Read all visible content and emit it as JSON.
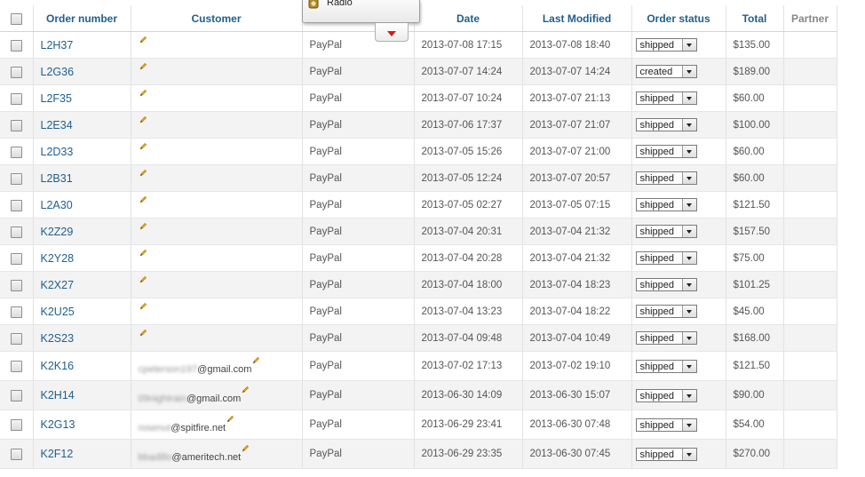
{
  "columns": {
    "order_number": "Order number",
    "customer": "Customer",
    "date": "Date",
    "last_modified": "Last Modified",
    "order_status": "Order status",
    "total": "Total",
    "partner": "Partner"
  },
  "popup": {
    "label": "Radio"
  },
  "colors": {
    "link": "#1f5f8f",
    "row_alt": "#f3f3f3",
    "toggle_arrow": "#d11a1a"
  },
  "orders": [
    {
      "number": "L2H37",
      "email_user": "",
      "email_domain": "",
      "payment": "PayPal",
      "date": "2013-07-08 17:15",
      "modified": "2013-07-08 18:40",
      "status": "shipped",
      "total": "$135.00"
    },
    {
      "number": "L2G36",
      "email_user": "",
      "email_domain": "",
      "payment": "PayPal",
      "date": "2013-07-07 14:24",
      "modified": "2013-07-07 14:24",
      "status": "created",
      "total": "$189.00"
    },
    {
      "number": "L2F35",
      "email_user": "",
      "email_domain": "",
      "payment": "PayPal",
      "date": "2013-07-07 10:24",
      "modified": "2013-07-07 21:13",
      "status": "shipped",
      "total": "$60.00"
    },
    {
      "number": "L2E34",
      "email_user": "",
      "email_domain": "",
      "payment": "PayPal",
      "date": "2013-07-06 17:37",
      "modified": "2013-07-07 21:07",
      "status": "shipped",
      "total": "$100.00"
    },
    {
      "number": "L2D33",
      "email_user": "",
      "email_domain": "",
      "payment": "PayPal",
      "date": "2013-07-05 15:26",
      "modified": "2013-07-07 21:00",
      "status": "shipped",
      "total": "$60.00"
    },
    {
      "number": "L2B31",
      "email_user": "",
      "email_domain": "",
      "payment": "PayPal",
      "date": "2013-07-05 12:24",
      "modified": "2013-07-07 20:57",
      "status": "shipped",
      "total": "$60.00"
    },
    {
      "number": "L2A30",
      "email_user": "",
      "email_domain": "",
      "payment": "PayPal",
      "date": "2013-07-05 02:27",
      "modified": "2013-07-05 07:15",
      "status": "shipped",
      "total": "$121.50"
    },
    {
      "number": "K2Z29",
      "email_user": "",
      "email_domain": "",
      "payment": "PayPal",
      "date": "2013-07-04 20:31",
      "modified": "2013-07-04 21:32",
      "status": "shipped",
      "total": "$157.50"
    },
    {
      "number": "K2Y28",
      "email_user": "",
      "email_domain": "",
      "payment": "PayPal",
      "date": "2013-07-04 20:28",
      "modified": "2013-07-04 21:32",
      "status": "shipped",
      "total": "$75.00"
    },
    {
      "number": "K2X27",
      "email_user": "",
      "email_domain": "",
      "payment": "PayPal",
      "date": "2013-07-04 18:00",
      "modified": "2013-07-04 18:23",
      "status": "shipped",
      "total": "$101.25"
    },
    {
      "number": "K2U25",
      "email_user": "",
      "email_domain": "",
      "payment": "PayPal",
      "date": "2013-07-04 13:23",
      "modified": "2013-07-04 18:22",
      "status": "shipped",
      "total": "$45.00"
    },
    {
      "number": "K2S23",
      "email_user": "",
      "email_domain": "",
      "payment": "PayPal",
      "date": "2013-07-04 09:48",
      "modified": "2013-07-04 10:49",
      "status": "shipped",
      "total": "$168.00"
    },
    {
      "number": "K2K16",
      "email_user": "cpeterson197",
      "email_domain": "@gmail.com",
      "payment": "PayPal",
      "date": "2013-07-02 17:13",
      "modified": "2013-07-02 19:10",
      "status": "shipped",
      "total": "$121.50"
    },
    {
      "number": "K2H14",
      "email_user": "09nightrain",
      "email_domain": "@gmail.com",
      "payment": "PayPal",
      "date": "2013-06-30 14:09",
      "modified": "2013-06-30 15:07",
      "status": "shipped",
      "total": "$90.00"
    },
    {
      "number": "K2G13",
      "email_user": "rosenut",
      "email_domain": "@spitfire.net",
      "payment": "PayPal",
      "date": "2013-06-29 23:41",
      "modified": "2013-06-30 07:48",
      "status": "shipped",
      "total": "$54.00"
    },
    {
      "number": "K2F12",
      "email_user": "bbadillo",
      "email_domain": "@ameritech.net",
      "payment": "PayPal",
      "date": "2013-06-29 23:35",
      "modified": "2013-06-30 07:45",
      "status": "shipped",
      "total": "$270.00"
    }
  ]
}
